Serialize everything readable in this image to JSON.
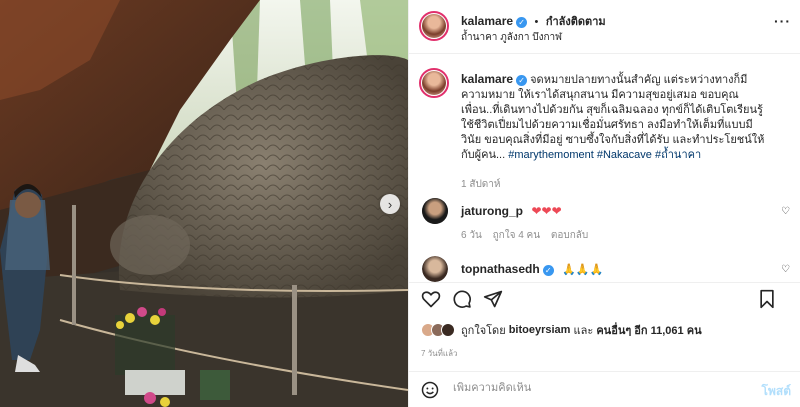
{
  "header": {
    "username": "kalamare",
    "separator": "•",
    "follow_label": "กำลังติดตาม",
    "location": "ถ้ำนาคา ภูลังกา บึงกาฬ",
    "more_icon": "more-horizontal-icon"
  },
  "caption": {
    "username": "kalamare",
    "text": "จดหมายปลายทางนั้นสำคัญ แต่ระหว่างทางก็มีความหมาย ให้เราได้สนุกสนาน มีความสุขอยู่เสมอ ขอบคุณเพื่อน..ที่เดินทางไปด้วยกัน สุขก็เฉลิมฉลอง ทุกข์ก็ได้เติบโตเรียนรู้ ใช้ชีวิตเปี่ยมไปด้วยความเชื่อมั่นศรัทธา ลงมือทำให้เต็มที่แบบมีวินัย ขอบคุณสิ่งที่มีอยู่ ซาบซึ้งใจกับสิ่งที่ได้รับ และทำประโยชน์ให้กับผู้คน...",
    "hashtags": [
      "#marythemoment",
      "#Nakacave",
      "#ถ้ำนาคา"
    ],
    "time": "1 สัปดาห์"
  },
  "comments": [
    {
      "username": "jaturong_p",
      "text": "❤❤❤",
      "time": "6 วัน",
      "likes": "ถูกใจ 4 คน",
      "reply": "ตอบกลับ",
      "verified": false
    },
    {
      "username": "topnathasedh",
      "text": "🙏🙏🙏",
      "verified": true
    }
  ],
  "actions": {
    "like_icon": "heart-icon",
    "comment_icon": "comment-icon",
    "share_icon": "share-icon",
    "save_icon": "bookmark-icon",
    "liked_by_prefix": "ถูกใจโดย",
    "liked_by_user": "bitoeyrsiam",
    "liked_by_mid": "และ",
    "liked_by_others": "คนอื่นๆ อีก 11,061 คน",
    "time_ago": "7 วันที่แล้ว"
  },
  "comment_box": {
    "emoji_icon": "smile-icon",
    "placeholder": "เพิ่มความคิดเห็น",
    "post_label": "โพสต์"
  },
  "media": {
    "next_icon": "chevron-right-icon"
  },
  "colors": {
    "verified": "#3897f0",
    "hashtag": "#00376b",
    "heart_red": "#ed4956",
    "post_disabled": "#b2dffc"
  }
}
